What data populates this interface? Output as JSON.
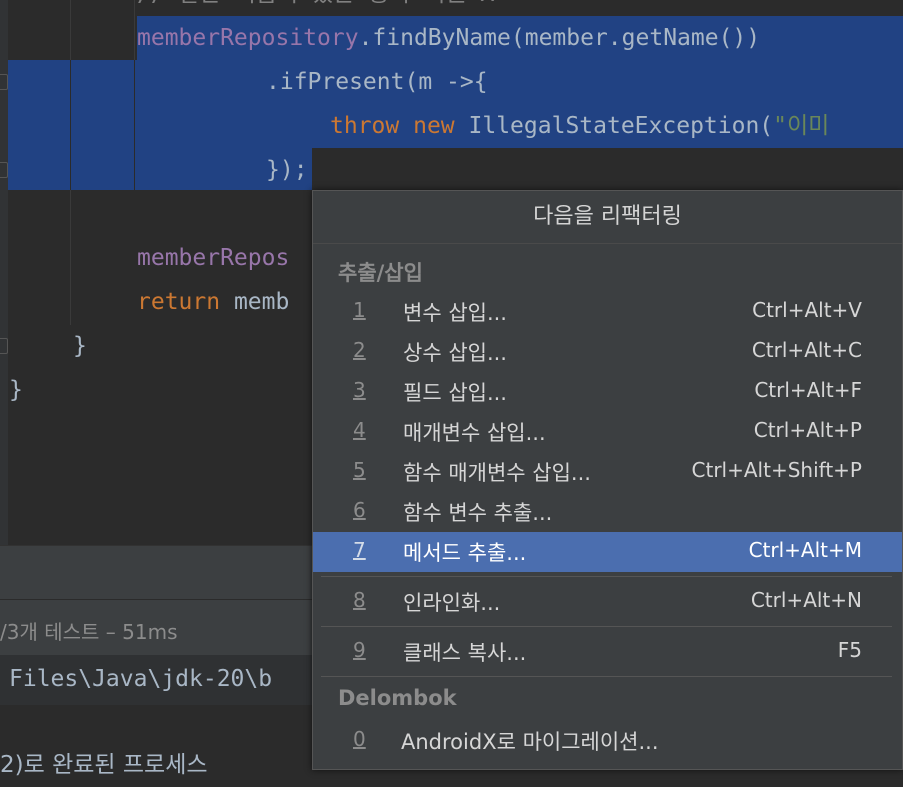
{
  "editor": {
    "line_partial": "// 같은 이름이 있는 중복 회원 X",
    "line1_a": "memberRepository",
    "line1_b": ".findByName(member.getName())",
    "line2": ".ifPresent(m ->{",
    "line3_throw": "throw",
    "line3_new": "new",
    "line3_class": "IllegalStateException(",
    "line3_str": "\"이미",
    "line4": "});",
    "line5": "memberRepos",
    "line6_kw": "return",
    "line6_rest": " memb",
    "brace1": "}",
    "brace2": "}"
  },
  "bottom_panel": {
    "test_status": "/3개 테스트 – 51ms",
    "path_text": "Files\\Java\\jdk-20\\b",
    "process_text": "2)로 완료된 프로세스"
  },
  "popup": {
    "title": "다음을 리팩터링",
    "section1": "추출/삽입",
    "section2": "Delombok",
    "items": [
      {
        "num": "1",
        "label": "변수 삽입...",
        "shortcut": "Ctrl+Alt+V"
      },
      {
        "num": "2",
        "label": "상수 삽입...",
        "shortcut": "Ctrl+Alt+C"
      },
      {
        "num": "3",
        "label": "필드 삽입...",
        "shortcut": "Ctrl+Alt+F"
      },
      {
        "num": "4",
        "label": "매개변수 삽입...",
        "shortcut": "Ctrl+Alt+P"
      },
      {
        "num": "5",
        "label": "함수 매개변수 삽입...",
        "shortcut": "Ctrl+Alt+Shift+P"
      },
      {
        "num": "6",
        "label": "함수 변수 추출...",
        "shortcut": ""
      },
      {
        "num": "7",
        "label": "메서드 추출...",
        "shortcut": "Ctrl+Alt+M"
      },
      {
        "num": "8",
        "label": "인라인화...",
        "shortcut": "Ctrl+Alt+N"
      },
      {
        "num": "9",
        "label": "클래스 복사...",
        "shortcut": "F5"
      },
      {
        "num": "0",
        "label": "AndroidX로 마이그레이션...",
        "shortcut": ""
      }
    ]
  },
  "colors": {
    "selection": "#214283",
    "active_item": "#4b6eaf",
    "field_purple": "#9876aa",
    "keyword_orange": "#cc7832",
    "string_green": "#6a8759"
  }
}
